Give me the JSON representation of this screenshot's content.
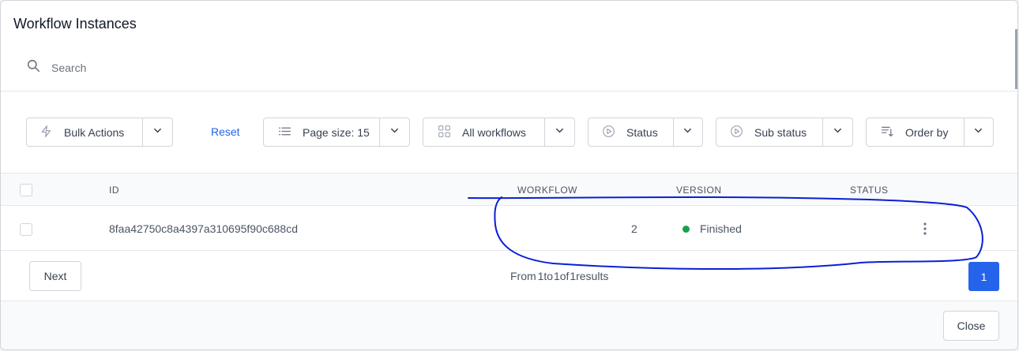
{
  "modal": {
    "title": "Workflow Instances"
  },
  "search": {
    "placeholder": "Search",
    "value": ""
  },
  "toolbar": {
    "bulk_actions": "Bulk Actions",
    "reset": "Reset",
    "page_size": "Page size: 15",
    "workflows": "All workflows",
    "status": "Status",
    "sub_status": "Sub status",
    "order_by": "Order by"
  },
  "table": {
    "columns": [
      "ID",
      "WORKFLOW",
      "VERSION",
      "STATUS"
    ],
    "rows": [
      {
        "id": "8faa42750c8a4397a310695f90c688cd",
        "workflow": "",
        "version": "2",
        "status": "Finished"
      }
    ]
  },
  "pagination": {
    "next": "Next",
    "from_label": "From",
    "from": "1",
    "to_label": "to",
    "to": "1",
    "of_label": "of",
    "total": "1",
    "results_label": "results",
    "current_page": "1"
  },
  "footer": {
    "close": "Close"
  },
  "colors": {
    "accent": "#2563eb",
    "finished": "#16a34a",
    "annotation": "#0a1fd6"
  },
  "icons": [
    "search-icon",
    "lightning-icon",
    "list-icon",
    "grid-icon",
    "play-circle-icon",
    "sort-icon",
    "chevron-down-icon",
    "kebab-icon"
  ]
}
